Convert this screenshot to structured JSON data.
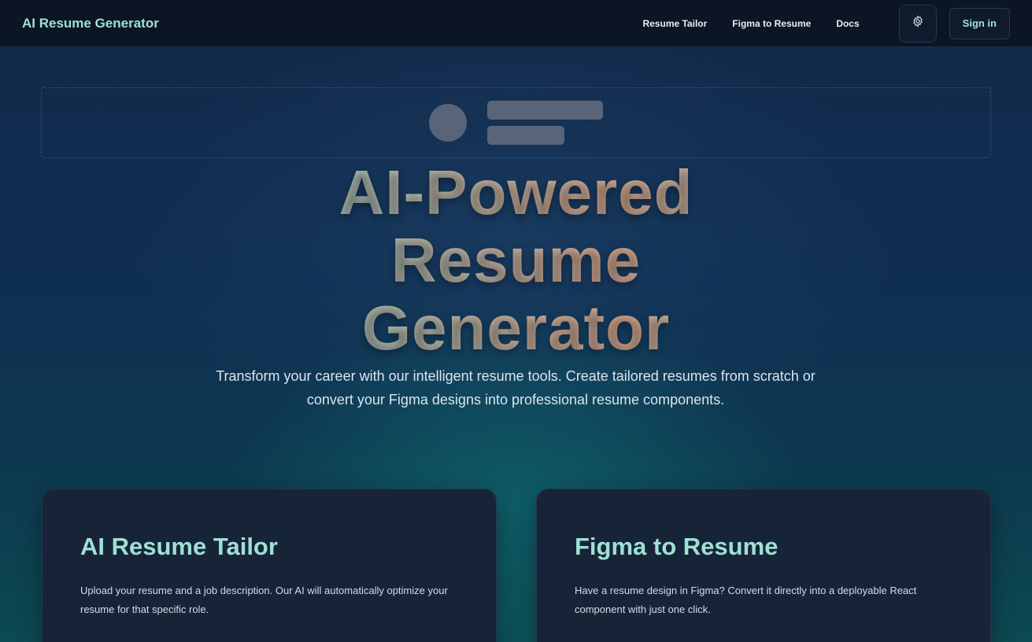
{
  "navbar": {
    "brand": "AI Resume Generator",
    "links": [
      "Resume Tailor",
      "Figma to Resume",
      "Docs"
    ],
    "settings_icon": "gear-icon",
    "signin_label": "Sign in"
  },
  "hero": {
    "title_lines": [
      "AI-Powered",
      "Resume",
      "Generator"
    ],
    "subtitle": "Transform your career with our intelligent resume tools. Create tailored resumes from scratch or convert your Figma designs into professional resume components."
  },
  "cards": [
    {
      "title": "AI Resume Tailor",
      "description": "Upload your resume and a job description. Our AI will automatically optimize your resume for that specific role."
    },
    {
      "title": "Figma to Resume",
      "description": "Have a resume design in Figma? Convert it directly into a deployable React component with just one click."
    }
  ],
  "colors": {
    "accent": "#9fe0d4",
    "navbar_bg": "#0c1524",
    "card_bg": "#172438",
    "placeholder": "#5a6478"
  }
}
